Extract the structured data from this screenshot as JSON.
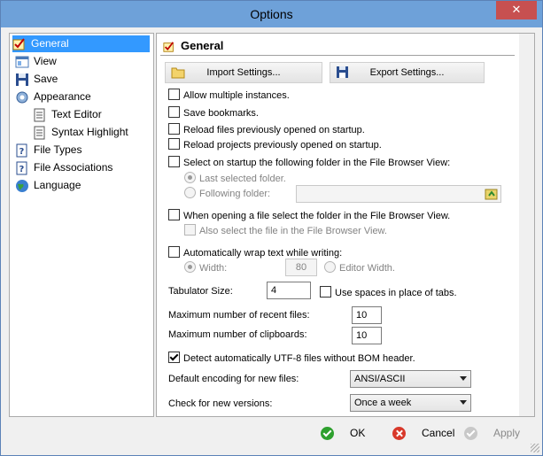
{
  "window": {
    "title": "Options",
    "close_glyph": "✕"
  },
  "sidebar": {
    "items": [
      {
        "label": "General",
        "icon": "general-check-icon",
        "selected": true
      },
      {
        "label": "View",
        "icon": "view-icon"
      },
      {
        "label": "Save",
        "icon": "floppy-disk-icon"
      },
      {
        "label": "Appearance",
        "icon": "appearance-gear-icon"
      },
      {
        "label": "Text Editor",
        "icon": "document-icon"
      },
      {
        "label": "Syntax Highlight",
        "icon": "document-icon"
      },
      {
        "label": "File Types",
        "icon": "file-types-icon"
      },
      {
        "label": "File Associations",
        "icon": "file-associations-icon"
      },
      {
        "label": "Language",
        "icon": "globe-icon"
      }
    ]
  },
  "main": {
    "section_title": "General",
    "import_button": "Import Settings...",
    "export_button": "Export Settings...",
    "options": {
      "allow_multiple": {
        "label": "Allow multiple instances.",
        "checked": false
      },
      "save_bookmarks": {
        "label": "Save bookmarks.",
        "checked": false
      },
      "reload_files": {
        "label": "Reload files previously opened on startup.",
        "checked": false
      },
      "reload_projects": {
        "label": "Reload projects previously opened on startup.",
        "checked": false
      },
      "select_startup_folder": {
        "label": "Select on startup the following folder in the File Browser View:",
        "checked": false
      },
      "last_selected_folder": {
        "label": "Last selected folder.",
        "selected": true
      },
      "following_folder": {
        "label": "Following folder:",
        "selected": false,
        "value": ""
      },
      "open_file_select_folder": {
        "label": "When opening a file select the folder in the File Browser View.",
        "checked": false
      },
      "also_select_file": {
        "label": "Also select the file in the File Browser View.",
        "checked": false
      },
      "auto_wrap": {
        "label": "Automatically wrap text while writing:",
        "checked": false
      },
      "wrap_width": {
        "label": "Width:",
        "selected": true,
        "value": "80"
      },
      "editor_width": {
        "label": "Editor Width.",
        "selected": false
      },
      "tab_size": {
        "label": "Tabulator Size:",
        "value": "4"
      },
      "use_spaces": {
        "label": "Use spaces in place of tabs.",
        "checked": false
      },
      "max_recent": {
        "label": "Maximum number of recent files:",
        "value": "10"
      },
      "max_clipboards": {
        "label": "Maximum number of clipboards:",
        "value": "10"
      },
      "detect_utf8": {
        "label": "Detect automatically UTF-8 files without BOM header.",
        "checked": true
      },
      "default_encoding": {
        "label": "Default encoding for new files:",
        "value": "ANSI/ASCII"
      },
      "check_versions": {
        "label": "Check for new versions:",
        "value": "Once a week"
      }
    }
  },
  "footer": {
    "ok": "OK",
    "cancel": "Cancel",
    "apply": "Apply"
  }
}
